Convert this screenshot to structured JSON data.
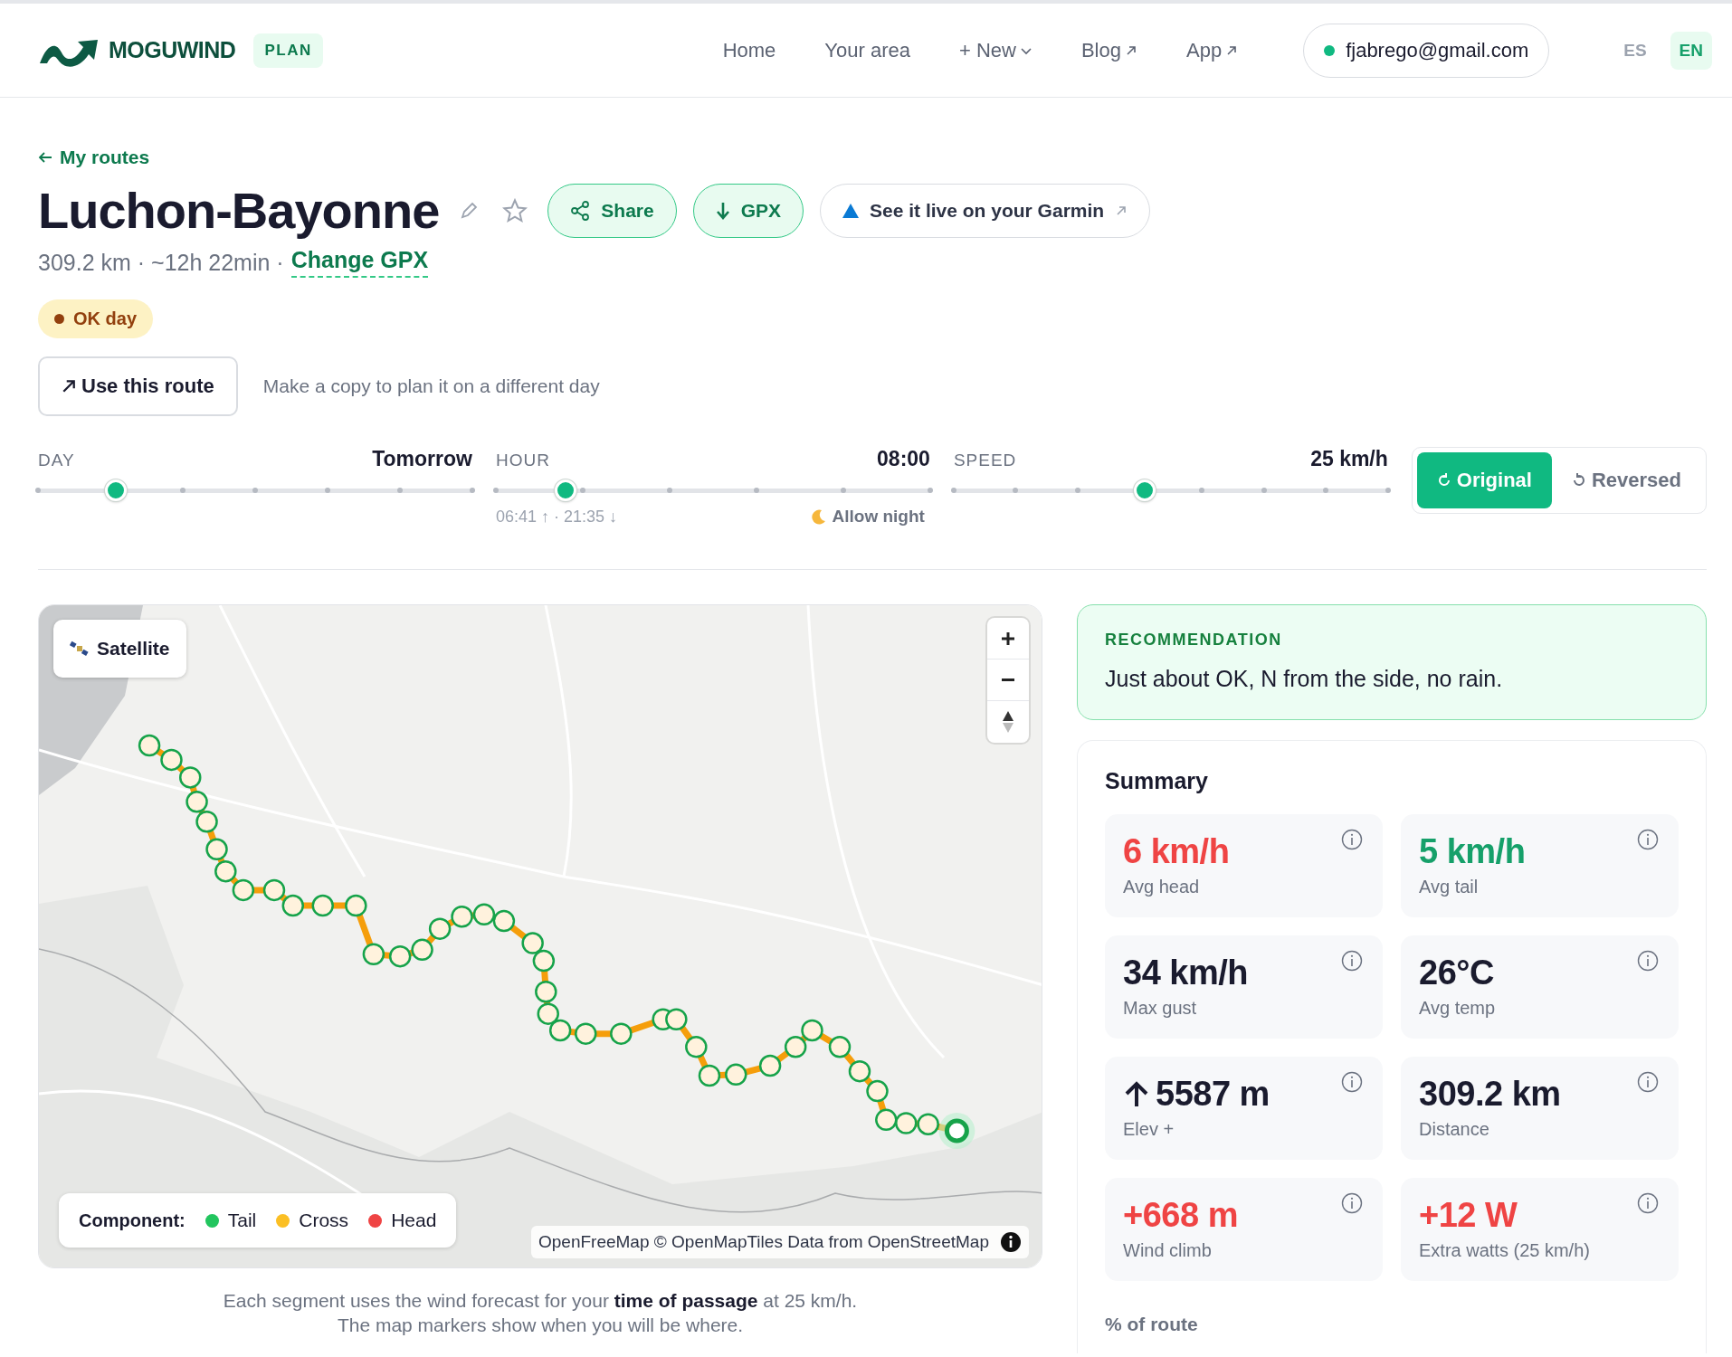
{
  "header": {
    "brand": "MOGUWIND",
    "badge": "PLAN",
    "nav": [
      {
        "label": "Home",
        "external": false,
        "dropdown": false
      },
      {
        "label": "Your area",
        "external": false,
        "dropdown": false
      },
      {
        "label": "+ New",
        "external": false,
        "dropdown": true
      },
      {
        "label": "Blog",
        "external": true,
        "dropdown": false
      },
      {
        "label": "App",
        "external": true,
        "dropdown": false
      }
    ],
    "account": "fjabrego@gmail.com",
    "languages": [
      {
        "label": "ES",
        "selected": false
      },
      {
        "label": "EN",
        "selected": true
      }
    ]
  },
  "back_link": "My routes",
  "route": {
    "title": "Luchon-Bayonne",
    "starred": false,
    "meta": "309.2 km · ~12h 22min ·",
    "change_link": "Change GPX",
    "actions": [
      {
        "label": "Share",
        "kind": "share"
      },
      {
        "label": "GPX",
        "kind": "download"
      },
      {
        "label": "See it live on your Garmin",
        "kind": "garmin"
      }
    ],
    "status": "OK day",
    "use_button": "Use this route",
    "use_hint": "Make a copy to plan it on a different day"
  },
  "controls": {
    "sliders": [
      {
        "label": "DAY",
        "value": "Tomorrow",
        "level": 0.18
      },
      {
        "label": "HOUR",
        "value": "08:00",
        "level": 0.16,
        "hint": "06:41 ↑ · 21:35 ↓",
        "extra": "Allow night"
      },
      {
        "label": "SPEED",
        "value": "25 km/h",
        "level": 0.44
      }
    ],
    "direction": [
      {
        "label": "Original",
        "selected": true
      },
      {
        "label": "Reversed",
        "selected": false
      }
    ]
  },
  "map": {
    "layer_button": "Satellite",
    "legend_title": "Component:",
    "legend": [
      {
        "label": "Tail",
        "color": "#22c55e"
      },
      {
        "label": "Cross",
        "color": "#fbbf24"
      },
      {
        "label": "Head",
        "color": "#ef4444"
      }
    ],
    "attribution": "OpenFreeMap © OpenMapTiles Data from OpenStreetMap",
    "caption": "Each segment uses the wind forecast for your **time of passage** at 25 km/h.",
    "caption_2": "The map markers show when you will be where."
  },
  "recommendation": {
    "title": "RECOMMENDATION",
    "text": "Just about OK, N from the side, no rain."
  },
  "summary": {
    "title": "Summary",
    "stats": [
      {
        "value": "6 km/h",
        "label": "Avg head",
        "color": "#ef4444",
        "kind": "plain"
      },
      {
        "value": "5 km/h",
        "label": "Avg tail",
        "color": "#16a06a",
        "kind": "plain"
      },
      {
        "value": "34 km/h",
        "label": "Max gust",
        "color": "#1a1b2e",
        "kind": "plain"
      },
      {
        "value": "26°C",
        "label": "Avg temp",
        "color": "#1a1b2e",
        "kind": "plain"
      },
      {
        "value": "5587 m",
        "label": "Elev +",
        "color": "#1a1b2e",
        "kind": "climb"
      },
      {
        "value": "309.2 km",
        "label": "Distance",
        "color": "#1a1b2e",
        "kind": "plain"
      },
      {
        "value": "+668 m",
        "label": "Wind climb",
        "color": "#ef4444",
        "kind": "plain"
      },
      {
        "value": "+12 W",
        "label": "Extra watts (25 km/h)",
        "color": "#ef4444",
        "kind": "plain"
      }
    ],
    "footer": "% of route"
  }
}
